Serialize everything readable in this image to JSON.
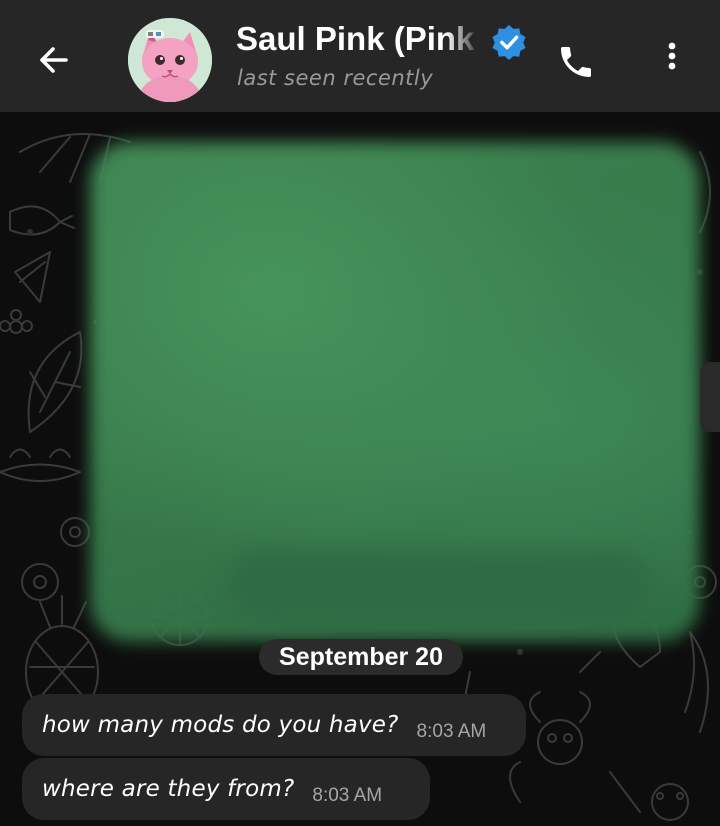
{
  "header": {
    "contact_name": "Saul Pink (Pink",
    "status": "last seen recently",
    "icons": [
      "arrow-left-icon",
      "verified-badge-icon",
      "phone-icon",
      "more-vertical-icon"
    ],
    "colors": {
      "bar": "#262626",
      "verified": "#2f8fe0"
    }
  },
  "chat": {
    "date_separator": "September 20",
    "messages": [
      {
        "text": "how many mods do you have?",
        "time": "8:03 AM"
      },
      {
        "text": "where are they from?",
        "time": "8:03 AM"
      }
    ],
    "colors": {
      "background": "#0d0d0d",
      "bubble": "#262626",
      "redaction": "#3b8250"
    }
  }
}
